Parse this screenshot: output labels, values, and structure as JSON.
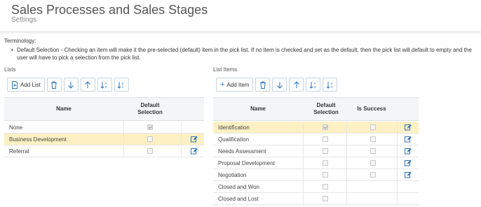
{
  "header": {
    "title": "Sales Processes and Sales Stages",
    "subtitle": "Settings"
  },
  "terminology": {
    "label": "Terminology:",
    "text": "Default Selection - Checking an item will make it the pre-selected (default) item in the pick list. If no item is checked and set as the default, then the pick list will default to empty and the user will have to pick a selection from the pick list."
  },
  "lists": {
    "section_label": "Lists",
    "add_label": "Add List",
    "columns": {
      "name": "Name",
      "default_selection": "Default Selection"
    },
    "rows": [
      {
        "name": "None",
        "default": true,
        "selected": false,
        "editable": false
      },
      {
        "name": "Business Development",
        "default": false,
        "selected": true,
        "editable": true
      },
      {
        "name": "Referral",
        "default": false,
        "selected": false,
        "editable": true
      }
    ]
  },
  "list_items": {
    "section_label": "List Items",
    "add_label": "Add Item",
    "columns": {
      "name": "Name",
      "default_selection": "Default Selection",
      "is_success": "Is Success"
    },
    "rows": [
      {
        "name": "Identification",
        "default": true,
        "success": false,
        "has_success": true,
        "selected": true,
        "editable": true
      },
      {
        "name": "Qualification",
        "default": false,
        "success": false,
        "has_success": true,
        "selected": false,
        "editable": true
      },
      {
        "name": "Needs Assessment",
        "default": false,
        "success": false,
        "has_success": true,
        "selected": false,
        "editable": true
      },
      {
        "name": "Proposal Development",
        "default": false,
        "success": false,
        "has_success": true,
        "selected": false,
        "editable": true
      },
      {
        "name": "Negotiation",
        "default": false,
        "success": false,
        "has_success": true,
        "selected": false,
        "editable": true
      },
      {
        "name": "Closed and Won",
        "default": false,
        "success": false,
        "has_success": false,
        "selected": false,
        "editable": false
      },
      {
        "name": "Closed and Lost",
        "default": false,
        "success": false,
        "has_success": false,
        "selected": false,
        "editable": false
      }
    ]
  },
  "icons": {
    "add": "add-document-icon",
    "delete": "trash-icon",
    "move_down": "arrow-down-icon",
    "move_up": "arrow-up-icon",
    "sort_az": "sort-ascending-icon",
    "sort_za": "sort-descending-icon",
    "edit": "edit-icon"
  },
  "colors": {
    "accent": "#2e73b8",
    "selected_row": "#fdf1c4"
  }
}
